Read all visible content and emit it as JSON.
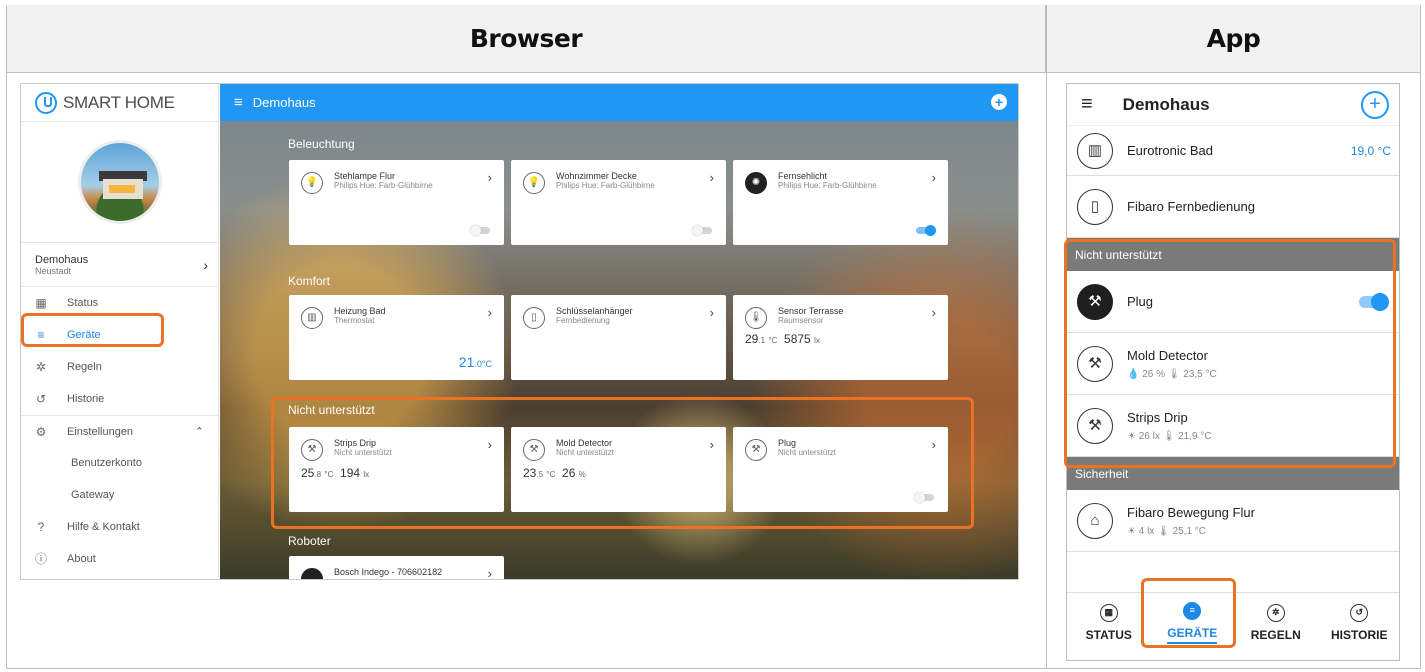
{
  "headers": {
    "browser": "Browser",
    "app": "App"
  },
  "browser": {
    "logo": "SMART HOME",
    "home": {
      "name": "Demohaus",
      "city": "Neustadt"
    },
    "nav": [
      {
        "label": "Status",
        "icon": "grid-icon"
      },
      {
        "label": "Geräte",
        "icon": "list-icon",
        "active": true
      },
      {
        "label": "Regeln",
        "icon": "magic-icon"
      },
      {
        "label": "Historie",
        "icon": "history-icon"
      },
      {
        "label": "Einstellungen",
        "icon": "gear-icon"
      },
      {
        "label": "Benutzerkonto"
      },
      {
        "label": "Gateway"
      },
      {
        "label": "Hilfe & Kontakt",
        "icon": "help-icon"
      },
      {
        "label": "About",
        "icon": "info-icon"
      }
    ],
    "topbar_title": "Demohaus",
    "sections": {
      "lighting": "Beleuchtung",
      "comfort": "Komfort",
      "unsupported": "Nicht unterstützt",
      "robots": "Roboter"
    },
    "cards": {
      "stehlampe": {
        "title": "Stehlampe Flur",
        "sub": "Philips Hue: Farb-Glühbirne"
      },
      "wohnzimmer": {
        "title": "Wohnzimmer Decke",
        "sub": "Philips Hue: Farb-Glühbirne"
      },
      "fernsehlicht": {
        "title": "Fernsehlicht",
        "sub": "Philips Hue: Farb-Glühbirne"
      },
      "heizung": {
        "title": "Heizung Bad",
        "sub": "Thermostat",
        "value": "21",
        "decimal": ".0",
        "unit": "°C"
      },
      "schluessel": {
        "title": "Schlüsselanhänger",
        "sub": "Fernbedienung"
      },
      "sensor": {
        "title": "Sensor Terrasse",
        "sub": "Raumsensor",
        "temp": "29",
        "temp_dec": ".1",
        "temp_unit": "°C",
        "lux": "5875",
        "lux_unit": "lx"
      },
      "strips": {
        "title": "Strips Drip",
        "sub": "Nicht unterstützt",
        "temp": "25",
        "temp_dec": ".8",
        "temp_unit": "°C",
        "lux": "194",
        "lux_unit": "lx"
      },
      "mold": {
        "title": "Mold Detector",
        "sub": "Nicht unterstützt",
        "temp": "23",
        "temp_dec": ".5",
        "temp_unit": "°C",
        "hum": "26",
        "hum_unit": "%"
      },
      "plug": {
        "title": "Plug",
        "sub": "Nicht unterstützt"
      },
      "bosch": {
        "title": "Bosch Indego - 706602182"
      }
    }
  },
  "app": {
    "title": "Demohaus",
    "rows": {
      "eurotronic": {
        "label": "Eurotronic Bad",
        "value": "19,0 °C"
      },
      "fibaro_remote": {
        "label": "Fibaro Fernbedienung"
      },
      "group_unsupported": "Nicht unterstützt",
      "plug": {
        "label": "Plug"
      },
      "mold": {
        "label": "Mold Detector",
        "sub": "💧 26 %   🌡 23,5 °C"
      },
      "strips": {
        "label": "Strips Drip",
        "sub": "☀ 26 lx   🌡 21,9 °C"
      },
      "group_security": "Sicherheit",
      "fibaro_motion": {
        "label": "Fibaro Bewegung Flur",
        "sub": "☀ 4 lx   🌡 25,1 °C"
      }
    },
    "tabs": [
      "STATUS",
      "GERÄTE",
      "REGELN",
      "HISTORIE"
    ]
  },
  "colors": {
    "accent": "#2196f3",
    "highlight": "#e97224"
  }
}
